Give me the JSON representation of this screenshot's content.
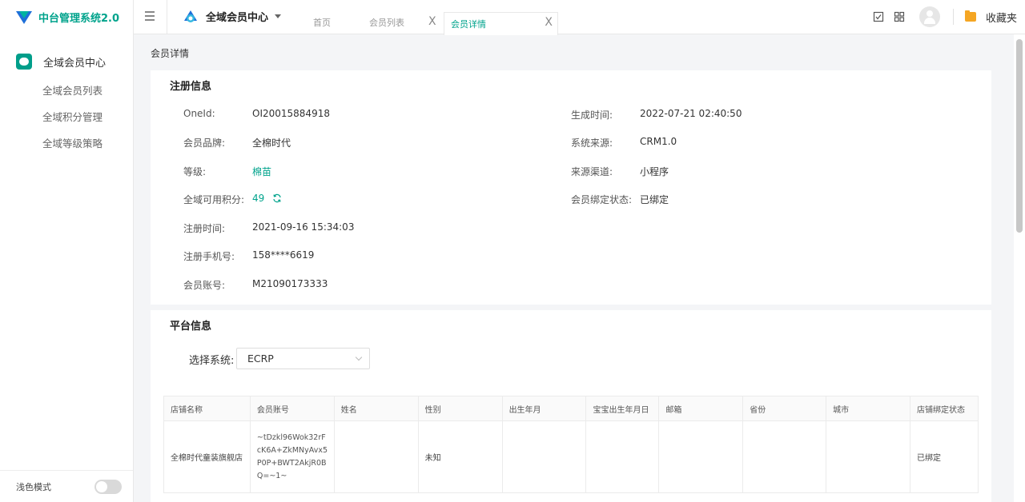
{
  "app": {
    "title": "中台管理系统2.0",
    "module": "全域会员中心"
  },
  "sidebar": {
    "group_label": "全域会员中心",
    "items": [
      {
        "label": "全域会员列表"
      },
      {
        "label": "全域积分管理"
      },
      {
        "label": "全域等级策略"
      }
    ],
    "footer_label": "浅色模式"
  },
  "tabs": [
    {
      "label": "首页"
    },
    {
      "label": "会员列表",
      "close": "X"
    },
    {
      "label": "会员详情",
      "close": "X",
      "active": true
    }
  ],
  "header": {
    "favorites_label": "收藏夹"
  },
  "page": {
    "title": "会员详情"
  },
  "registration": {
    "title": "注册信息",
    "left": [
      {
        "label": "OneId:",
        "value": "OI20015884918"
      },
      {
        "label": "会员品牌:",
        "value": "全棉时代"
      },
      {
        "label": "等级:",
        "value": "棉苗"
      },
      {
        "label": "全域可用积分:",
        "value": "49"
      },
      {
        "label": "注册时间:",
        "value": "2021-09-16 15:34:03"
      },
      {
        "label": "注册手机号:",
        "value": "158****6619"
      },
      {
        "label": "会员账号:",
        "value": "M21090173333"
      }
    ],
    "right": [
      {
        "label": "生成时间:",
        "value": "2022-07-21 02:40:50"
      },
      {
        "label": "系统来源:",
        "value": "CRM1.0"
      },
      {
        "label": "来源渠道:",
        "value": "小程序"
      },
      {
        "label": "会员绑定状态:",
        "value": "已绑定"
      }
    ]
  },
  "platform": {
    "title": "平台信息",
    "select_label": "选择系统:",
    "select_value": "ECRP",
    "columns": [
      "店铺名称",
      "会员账号",
      "姓名",
      "性别",
      "出生年月",
      "宝宝出生年月日",
      "邮箱",
      "省份",
      "城市",
      "店铺绑定状态"
    ],
    "rows": [
      [
        "全棉时代童装旗舰店",
        "~tDzkl96Wok32rFcK6A+ZkMNyAvx5P0P+BWT2AkjR0BQ=~1~",
        "",
        "未知",
        "",
        "",
        "",
        "",
        "",
        "已绑定"
      ]
    ]
  },
  "colors": {
    "accent": "#00a38c",
    "brand_blue": "#1e6fd9"
  }
}
